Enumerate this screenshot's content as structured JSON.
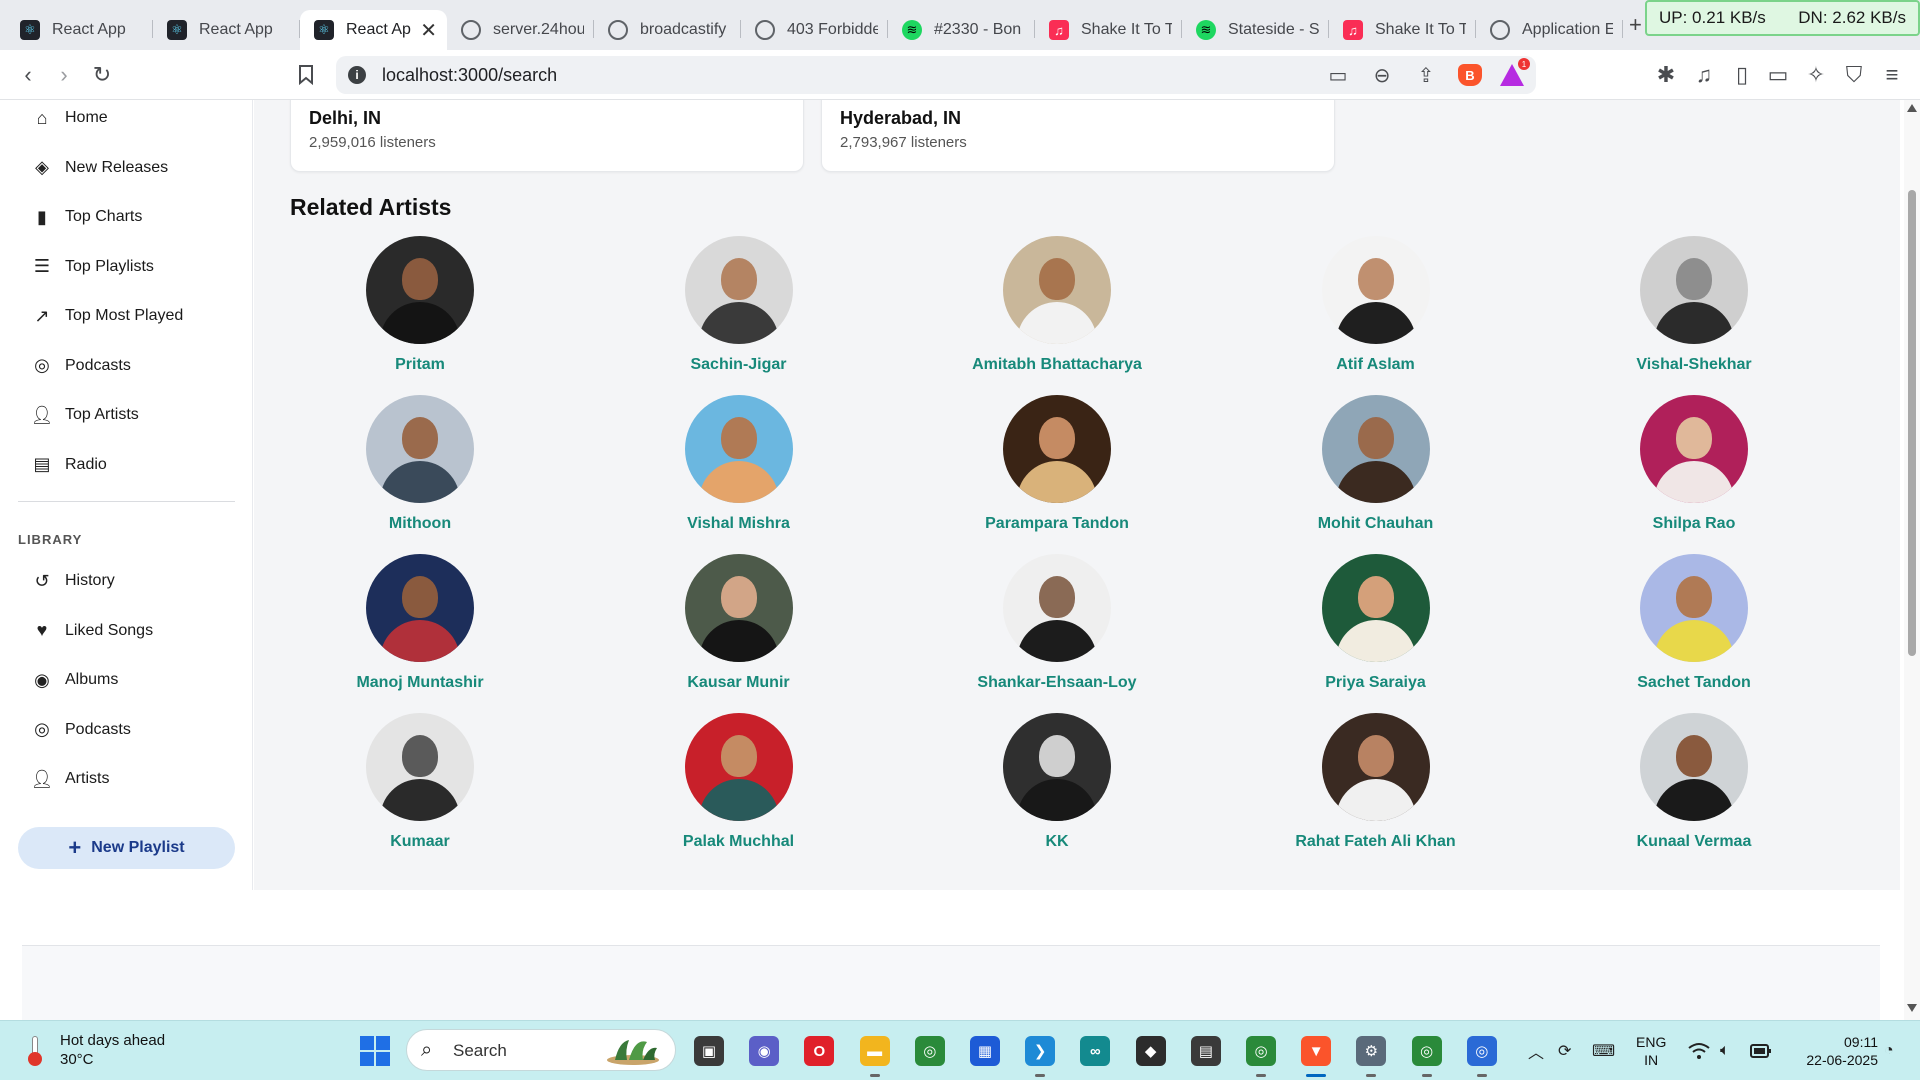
{
  "browser": {
    "tabs": [
      {
        "title": "React App",
        "favicon": "react-icon",
        "active": false
      },
      {
        "title": "React App",
        "favicon": "react-icon",
        "active": false
      },
      {
        "title": "React Ap",
        "favicon": "react-icon",
        "active": true
      },
      {
        "title": "server.24hou",
        "favicon": "globe-icon",
        "active": false
      },
      {
        "title": "broadcastify",
        "favicon": "globe-icon",
        "active": false
      },
      {
        "title": "403 Forbidde",
        "favicon": "globe-icon",
        "active": false
      },
      {
        "title": "#2330 - Bon",
        "favicon": "spotify-icon",
        "active": false
      },
      {
        "title": "Shake It To T",
        "favicon": "music-icon",
        "active": false
      },
      {
        "title": "Stateside - S",
        "favicon": "spotify-icon",
        "active": false
      },
      {
        "title": "Shake It To T",
        "favicon": "music-icon",
        "active": false
      },
      {
        "title": "Application E",
        "favicon": "globe-icon",
        "active": false
      }
    ],
    "new_tab_symbol": "+",
    "close_symbol": "✕",
    "net_speed": {
      "up": "UP: 0.21 KB/s",
      "down": "DN: 2.62 KB/s"
    },
    "address": "localhost:3000/search",
    "info_symbol": "i",
    "rewards_badge": "1"
  },
  "sidebar": {
    "nav_items": [
      {
        "label": "Home",
        "icon": "home-icon"
      },
      {
        "label": "New Releases",
        "icon": "compass-icon"
      },
      {
        "label": "Top Charts",
        "icon": "bar-chart-icon"
      },
      {
        "label": "Top Playlists",
        "icon": "playlist-icon"
      },
      {
        "label": "Top Most Played",
        "icon": "trending-icon"
      },
      {
        "label": "Podcasts",
        "icon": "podcast-icon"
      },
      {
        "label": "Top Artists",
        "icon": "person-icon"
      },
      {
        "label": "Radio",
        "icon": "radio-icon"
      }
    ],
    "library_heading": "LIBRARY",
    "library_items": [
      {
        "label": "History",
        "icon": "history-icon"
      },
      {
        "label": "Liked Songs",
        "icon": "heart-icon"
      },
      {
        "label": "Albums",
        "icon": "album-icon"
      },
      {
        "label": "Podcasts",
        "icon": "podcast-icon"
      },
      {
        "label": "Artists",
        "icon": "person-icon"
      }
    ],
    "new_playlist": {
      "plus": "+",
      "label": "New Playlist"
    }
  },
  "main": {
    "cities": [
      {
        "name": "Delhi, IN",
        "listeners": "2,959,016 listeners"
      },
      {
        "name": "Hyderabad, IN",
        "listeners": "2,793,967 listeners"
      }
    ],
    "related_title": "Related Artists",
    "artists": [
      {
        "name": "Pritam",
        "bg": "#2a2a2a",
        "skin": "#8a5a3e",
        "cloth": "#141414"
      },
      {
        "name": "Sachin-Jigar",
        "bg": "#d9d9d9",
        "skin": "#b48463",
        "cloth": "#3a3a3a"
      },
      {
        "name": "Amitabh Bhattacharya",
        "bg": "#c9b79a",
        "skin": "#a8754f",
        "cloth": "#f2f2f2"
      },
      {
        "name": "Atif Aslam",
        "bg": "#f3f3f3",
        "skin": "#c09070",
        "cloth": "#1f1f1f"
      },
      {
        "name": "Vishal-Shekhar",
        "bg": "#cfcfcf",
        "skin": "#8e8e8e",
        "cloth": "#2b2b2b"
      },
      {
        "name": "Mithoon",
        "bg": "#b9c3cf",
        "skin": "#9a6a4c",
        "cloth": "#3a4a5a"
      },
      {
        "name": "Vishal Mishra",
        "bg": "#6bb7e0",
        "skin": "#b07a55",
        "cloth": "#e4a46a"
      },
      {
        "name": "Parampara Tandon",
        "bg": "#3a2415",
        "skin": "#c58b63",
        "cloth": "#d9b27a"
      },
      {
        "name": "Mohit Chauhan",
        "bg": "#8fa6b7",
        "skin": "#9a6a4c",
        "cloth": "#3b2a20"
      },
      {
        "name": "Shilpa Rao",
        "bg": "#b0205a",
        "skin": "#e0b89a",
        "cloth": "#f0e6e6"
      },
      {
        "name": "Manoj Muntashir",
        "bg": "#1d2e5a",
        "skin": "#8a5a3e",
        "cloth": "#b0303a"
      },
      {
        "name": "Kausar Munir",
        "bg": "#4d5a4a",
        "skin": "#d2a587",
        "cloth": "#151515"
      },
      {
        "name": "Shankar-Ehsaan-Loy",
        "bg": "#efefef",
        "skin": "#8a6a55",
        "cloth": "#1c1c1c"
      },
      {
        "name": "Priya Saraiya",
        "bg": "#1e5a3a",
        "skin": "#d4a07a",
        "cloth": "#f1ece0"
      },
      {
        "name": "Sachet Tandon",
        "bg": "#aab8e6",
        "skin": "#b07a55",
        "cloth": "#e8d84a"
      },
      {
        "name": "Kumaar",
        "bg": "#e4e4e4",
        "skin": "#5a5a5a",
        "cloth": "#2a2a2a"
      },
      {
        "name": "Palak Muchhal",
        "bg": "#c8202a",
        "skin": "#c58b63",
        "cloth": "#2a5a5a"
      },
      {
        "name": "KK",
        "bg": "#2f2f2f",
        "skin": "#cfcfcf",
        "cloth": "#181818"
      },
      {
        "name": "Rahat Fateh Ali Khan",
        "bg": "#3a2a22",
        "skin": "#b88262",
        "cloth": "#f0f0f0"
      },
      {
        "name": "Kunaal Vermaa",
        "bg": "#cfd3d6",
        "skin": "#8a5a3e",
        "cloth": "#1a1a1a"
      }
    ]
  },
  "taskbar": {
    "weather_title": "Hot days ahead",
    "weather_temp": "30°C",
    "search_placeholder": "Search",
    "language": "ENG",
    "region": "IN",
    "time": "09:11",
    "date": "22-06-2025",
    "apps": [
      {
        "name": "task-view",
        "icon": "task-view-icon",
        "color": "#3a3a3a",
        "glyph": "▣",
        "running": false
      },
      {
        "name": "meet",
        "icon": "meet-icon",
        "color": "#5b5fc7",
        "glyph": "◉",
        "running": false
      },
      {
        "name": "opera",
        "icon": "opera-icon",
        "color": "#e0202a",
        "glyph": "O",
        "running": false
      },
      {
        "name": "file-explorer",
        "icon": "folder-icon",
        "color": "#f2b51e",
        "glyph": "▬",
        "running": true
      },
      {
        "name": "chrome",
        "icon": "chrome-icon",
        "color": "#2a8a3a",
        "glyph": "◎",
        "running": false
      },
      {
        "name": "store",
        "icon": "store-icon",
        "color": "#1d5bd6",
        "glyph": "▦",
        "running": false
      },
      {
        "name": "vscode",
        "icon": "vscode-icon",
        "color": "#1e8ad6",
        "glyph": "❯",
        "running": true
      },
      {
        "name": "arduino",
        "icon": "arduino-icon",
        "color": "#138a8f",
        "glyph": "∞",
        "running": false
      },
      {
        "name": "figma",
        "icon": "figma-icon",
        "color": "#2c2c2c",
        "glyph": "◆",
        "running": false
      },
      {
        "name": "terminal",
        "icon": "terminal-icon",
        "color": "#3a3a3a",
        "glyph": "▤",
        "running": false
      },
      {
        "name": "chrome-profile",
        "icon": "chrome-icon",
        "color": "#2a8a3a",
        "glyph": "◎",
        "running": true
      },
      {
        "name": "brave",
        "icon": "brave-icon",
        "color": "#fb542b",
        "glyph": "▼",
        "running": true
      },
      {
        "name": "settings",
        "icon": "gear-icon",
        "color": "#5a6a7a",
        "glyph": "⚙",
        "running": true
      },
      {
        "name": "chrome-dev",
        "icon": "chrome-icon",
        "color": "#2a8a3a",
        "glyph": "◎",
        "running": true
      },
      {
        "name": "chrome-canary",
        "icon": "chrome-icon",
        "color": "#2a6ad6",
        "glyph": "◎",
        "running": true
      }
    ]
  },
  "colors": {
    "artist_name": "#17897a",
    "page_bg": "#f4f5f7",
    "new_playlist_bg": "#dbe8f8"
  }
}
